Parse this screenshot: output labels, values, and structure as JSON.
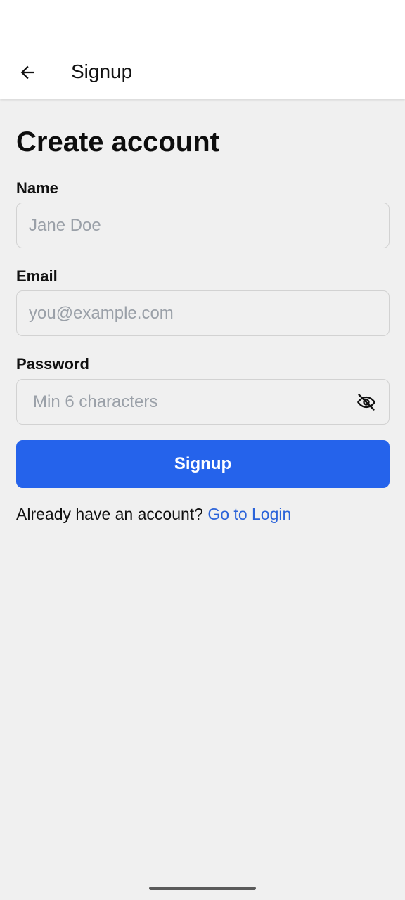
{
  "appbar": {
    "title": "Signup",
    "back_icon": "arrow-left-icon"
  },
  "form": {
    "heading": "Create account",
    "name": {
      "label": "Name",
      "placeholder": "Jane Doe",
      "value": ""
    },
    "email": {
      "label": "Email",
      "placeholder": "you@example.com",
      "value": ""
    },
    "password": {
      "label": "Password",
      "placeholder": "Min 6 characters",
      "value": "",
      "toggle_icon": "eye-off-icon"
    },
    "submit_label": "Signup"
  },
  "footer": {
    "prompt": "Already have an account?",
    "link_label": "Go to Login"
  },
  "colors": {
    "accent": "#2563eb",
    "link": "#2b63d9",
    "background": "#f0f0f0",
    "appbar": "#ffffff"
  }
}
